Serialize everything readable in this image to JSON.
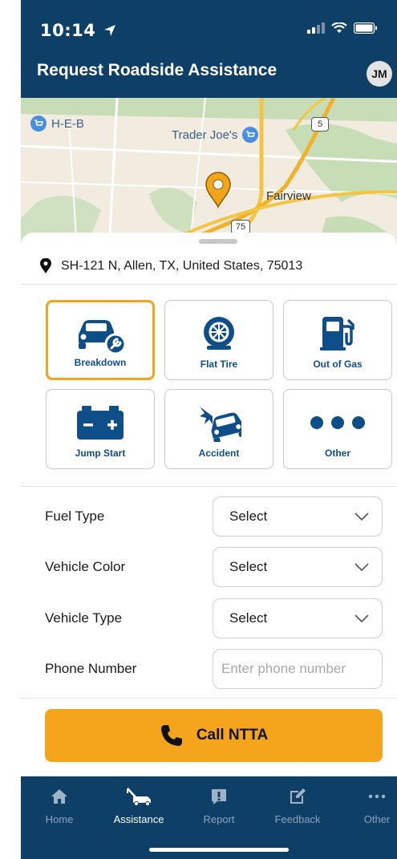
{
  "status_bar": {
    "time": "10:14"
  },
  "header": {
    "title": "Request Roadside Assistance",
    "avatar_initials": "JM"
  },
  "map": {
    "labels": {
      "heb": "H-E-B",
      "trader_joes": "Trader Joe's",
      "fairview": "Fairview",
      "route_5": "5",
      "route_75": "75"
    }
  },
  "location": {
    "address": "SH-121 N, Allen, TX, United States, 75013"
  },
  "services": [
    {
      "label": "Breakdown",
      "icon": "car-wrench-icon",
      "selected": true
    },
    {
      "label": "Flat Tire",
      "icon": "tire-icon",
      "selected": false
    },
    {
      "label": "Out of Gas",
      "icon": "fuel-pump-icon",
      "selected": false
    },
    {
      "label": "Jump Start",
      "icon": "battery-icon",
      "selected": false
    },
    {
      "label": "Accident",
      "icon": "car-crash-icon",
      "selected": false
    },
    {
      "label": "Other",
      "icon": "more-dots-icon",
      "selected": false
    }
  ],
  "form": {
    "fuel_type": {
      "label": "Fuel Type",
      "value": "Select"
    },
    "vehicle_color": {
      "label": "Vehicle Color",
      "value": "Select"
    },
    "vehicle_type": {
      "label": "Vehicle Type",
      "value": "Select"
    },
    "phone_number": {
      "label": "Phone Number",
      "placeholder": "Enter phone number"
    }
  },
  "call_button": {
    "label": "Call NTTA"
  },
  "tabs": [
    {
      "label": "Home",
      "icon": "home-icon",
      "active": false
    },
    {
      "label": "Assistance",
      "icon": "tow-truck-icon",
      "active": true
    },
    {
      "label": "Report",
      "icon": "report-icon",
      "active": false
    },
    {
      "label": "Feedback",
      "icon": "feedback-icon",
      "active": false
    },
    {
      "label": "Other",
      "icon": "more-dots-icon",
      "active": false
    }
  ],
  "colors": {
    "header_bg": "#0e3f66",
    "accent": "#f5a51c",
    "icon_blue": "#0e4f8a",
    "selected_border": "#f2a51a"
  }
}
